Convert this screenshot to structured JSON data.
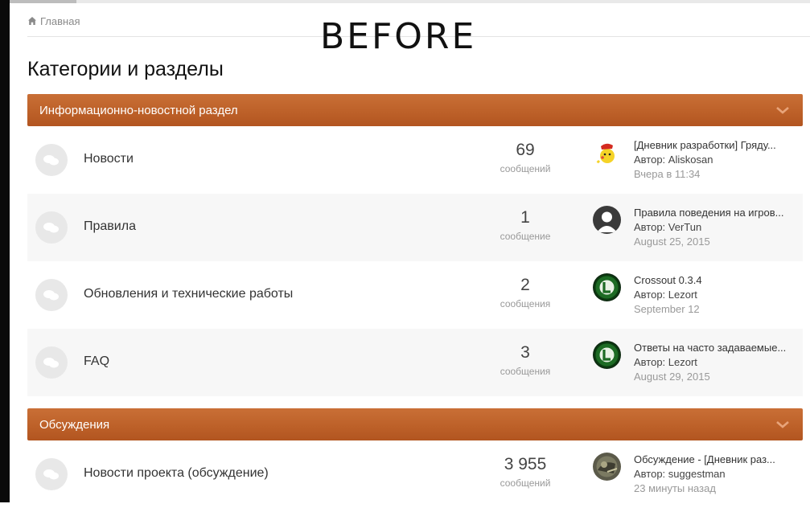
{
  "overlay": {
    "watermark": "BEFORE"
  },
  "breadcrumb": {
    "home_label": "Главная",
    "icon": "home-icon"
  },
  "page": {
    "title": "Категории и разделы"
  },
  "colors": {
    "category_header": "#bd6129",
    "category_text": "#ffffff",
    "muted": "#999999"
  },
  "categories": [
    {
      "title": "Информационно-новостной раздел",
      "forums": [
        {
          "title": "Новости",
          "count": "69",
          "count_label": "сообщений",
          "last_post": {
            "title": "[Дневник разработки] Гряду...",
            "author": "Автор: Aliskosan",
            "date": "Вчера в 11:34",
            "avatar": "pikachu-avatar"
          }
        },
        {
          "title": "Правила",
          "count": "1",
          "count_label": "сообщение",
          "last_post": {
            "title": "Правила поведения на игров...",
            "author": "Автор: VerTun",
            "date": "August 25, 2015",
            "avatar": "default-user-avatar"
          }
        },
        {
          "title": "Обновления и технические работы",
          "count": "2",
          "count_label": "сообщения",
          "last_post": {
            "title": "Crossout 0.3.4",
            "author": "Автор: Lezort",
            "date": "September 12",
            "avatar": "green-emblem-avatar"
          }
        },
        {
          "title": "FAQ",
          "count": "3",
          "count_label": "сообщения",
          "last_post": {
            "title": "Ответы на часто задаваемые...",
            "author": "Автор: Lezort",
            "date": "August 29, 2015",
            "avatar": "green-emblem-avatar"
          }
        }
      ]
    },
    {
      "title": "Обсуждения",
      "forums": [
        {
          "title": "Новости проекта (обсуждение)",
          "count": "3 955",
          "count_label": "сообщений",
          "last_post": {
            "title": "Обсуждение - [Дневник раз...",
            "author": "Автор: suggestman",
            "date": "23 минуты назад",
            "avatar": "photo-avatar"
          }
        }
      ]
    }
  ]
}
